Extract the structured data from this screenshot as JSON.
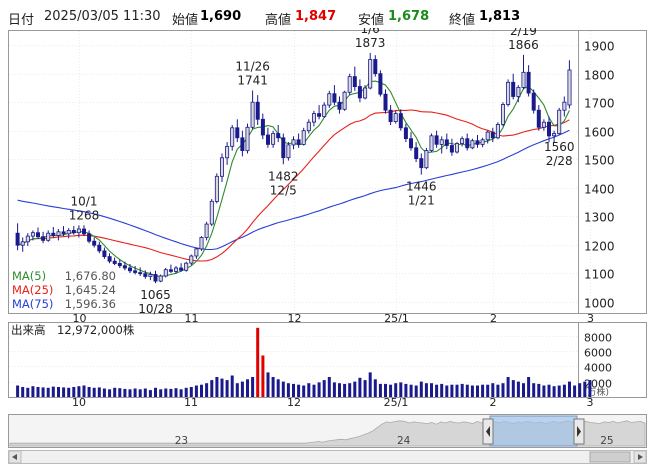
{
  "header": {
    "date_label": "日付",
    "datetime": "2025/03/05 11:30",
    "open_label": "始値",
    "open": "1,690",
    "high_label": "高値",
    "high": "1,847",
    "low_label": "安値",
    "low": "1,678",
    "close_label": "終値",
    "close": "1,813"
  },
  "colors": {
    "up": "#d9d9d9",
    "up_border": "#1a1a8c",
    "down": "#1a1a8c",
    "ma5": "#2e8b2e",
    "ma25": "#e8211a",
    "ma75": "#2a3fd6",
    "high": "#e00000",
    "low": "#1a8c1a",
    "volume": "#1a1a8c",
    "volume_spike": "#e00000"
  },
  "chart_data": {
    "type": "candlestick",
    "yticks": [
      1000,
      1100,
      1200,
      1300,
      1400,
      1500,
      1600,
      1700,
      1800,
      1900
    ],
    "ylim": [
      960,
      1950
    ],
    "x_month_labels": [
      {
        "label": "10",
        "index": 12
      },
      {
        "label": "11",
        "index": 34
      },
      {
        "label": "12",
        "index": 54
      },
      {
        "label": "25/1",
        "index": 74
      },
      {
        "label": "2",
        "index": 93
      },
      {
        "label": "3",
        "index": 112
      }
    ],
    "candles": [
      [
        1240,
        1275,
        1180,
        1198
      ],
      [
        1198,
        1225,
        1175,
        1210
      ],
      [
        1210,
        1240,
        1195,
        1230
      ],
      [
        1230,
        1250,
        1215,
        1242
      ],
      [
        1242,
        1260,
        1220,
        1228
      ],
      [
        1228,
        1245,
        1205,
        1215
      ],
      [
        1215,
        1250,
        1210,
        1240
      ],
      [
        1240,
        1262,
        1225,
        1232
      ],
      [
        1232,
        1255,
        1215,
        1245
      ],
      [
        1245,
        1265,
        1230,
        1238
      ],
      [
        1238,
        1258,
        1222,
        1250
      ],
      [
        1250,
        1265,
        1235,
        1242
      ],
      [
        1242,
        1268,
        1225,
        1255
      ],
      [
        1255,
        1268,
        1230,
        1238
      ],
      [
        1238,
        1250,
        1205,
        1212
      ],
      [
        1212,
        1225,
        1190,
        1198
      ],
      [
        1198,
        1210,
        1170,
        1178
      ],
      [
        1178,
        1190,
        1150,
        1158
      ],
      [
        1158,
        1170,
        1135,
        1142
      ],
      [
        1142,
        1155,
        1125,
        1134
      ],
      [
        1134,
        1148,
        1118,
        1126
      ],
      [
        1126,
        1140,
        1110,
        1118
      ],
      [
        1118,
        1132,
        1100,
        1108
      ],
      [
        1108,
        1125,
        1095,
        1102
      ],
      [
        1102,
        1120,
        1090,
        1098
      ],
      [
        1098,
        1110,
        1080,
        1088
      ],
      [
        1088,
        1105,
        1075,
        1095
      ],
      [
        1095,
        1108,
        1065,
        1072
      ],
      [
        1072,
        1095,
        1068,
        1090
      ],
      [
        1090,
        1118,
        1085,
        1112
      ],
      [
        1112,
        1130,
        1100,
        1106
      ],
      [
        1106,
        1125,
        1098,
        1118
      ],
      [
        1118,
        1135,
        1105,
        1110
      ],
      [
        1110,
        1140,
        1105,
        1135
      ],
      [
        1135,
        1165,
        1128,
        1160
      ],
      [
        1160,
        1190,
        1150,
        1185
      ],
      [
        1185,
        1230,
        1178,
        1225
      ],
      [
        1225,
        1280,
        1215,
        1272
      ],
      [
        1272,
        1360,
        1265,
        1352
      ],
      [
        1352,
        1450,
        1345,
        1440
      ],
      [
        1440,
        1520,
        1420,
        1505
      ],
      [
        1505,
        1560,
        1480,
        1545
      ],
      [
        1545,
        1620,
        1530,
        1610
      ],
      [
        1610,
        1640,
        1560,
        1575
      ],
      [
        1575,
        1600,
        1510,
        1530
      ],
      [
        1530,
        1625,
        1520,
        1612
      ],
      [
        1612,
        1741,
        1605,
        1700
      ],
      [
        1700,
        1725,
        1620,
        1640
      ],
      [
        1640,
        1660,
        1570,
        1585
      ],
      [
        1585,
        1610,
        1540,
        1552
      ],
      [
        1552,
        1600,
        1540,
        1590
      ],
      [
        1590,
        1620,
        1560,
        1575
      ],
      [
        1575,
        1590,
        1482,
        1505
      ],
      [
        1505,
        1560,
        1495,
        1550
      ],
      [
        1550,
        1580,
        1535,
        1568
      ],
      [
        1568,
        1590,
        1540,
        1552
      ],
      [
        1552,
        1610,
        1548,
        1600
      ],
      [
        1600,
        1640,
        1590,
        1630
      ],
      [
        1630,
        1670,
        1615,
        1660
      ],
      [
        1660,
        1690,
        1640,
        1650
      ],
      [
        1650,
        1700,
        1645,
        1690
      ],
      [
        1690,
        1740,
        1680,
        1730
      ],
      [
        1730,
        1760,
        1690,
        1700
      ],
      [
        1700,
        1720,
        1660,
        1675
      ],
      [
        1675,
        1740,
        1670,
        1735
      ],
      [
        1735,
        1800,
        1725,
        1790
      ],
      [
        1790,
        1825,
        1740,
        1755
      ],
      [
        1755,
        1780,
        1700,
        1715
      ],
      [
        1715,
        1760,
        1710,
        1750
      ],
      [
        1750,
        1873,
        1745,
        1850
      ],
      [
        1850,
        1865,
        1790,
        1800
      ],
      [
        1800,
        1812,
        1720,
        1728
      ],
      [
        1728,
        1745,
        1660,
        1672
      ],
      [
        1672,
        1690,
        1620,
        1632
      ],
      [
        1632,
        1670,
        1625,
        1660
      ],
      [
        1660,
        1675,
        1600,
        1610
      ],
      [
        1610,
        1625,
        1560,
        1572
      ],
      [
        1572,
        1595,
        1530,
        1540
      ],
      [
        1540,
        1560,
        1490,
        1502
      ],
      [
        1502,
        1520,
        1446,
        1470
      ],
      [
        1470,
        1540,
        1465,
        1530
      ],
      [
        1530,
        1590,
        1525,
        1582
      ],
      [
        1582,
        1600,
        1540,
        1552
      ],
      [
        1552,
        1580,
        1520,
        1568
      ],
      [
        1568,
        1590,
        1535,
        1548
      ],
      [
        1548,
        1572,
        1512,
        1525
      ],
      [
        1525,
        1560,
        1520,
        1555
      ],
      [
        1555,
        1580,
        1545,
        1572
      ],
      [
        1572,
        1590,
        1530,
        1540
      ],
      [
        1540,
        1572,
        1535,
        1565
      ],
      [
        1565,
        1585,
        1540,
        1552
      ],
      [
        1552,
        1575,
        1542,
        1568
      ],
      [
        1568,
        1600,
        1555,
        1595
      ],
      [
        1595,
        1610,
        1560,
        1575
      ],
      [
        1575,
        1630,
        1570,
        1622
      ],
      [
        1622,
        1700,
        1615,
        1692
      ],
      [
        1692,
        1780,
        1685,
        1770
      ],
      [
        1770,
        1800,
        1710,
        1720
      ],
      [
        1720,
        1760,
        1700,
        1752
      ],
      [
        1752,
        1866,
        1745,
        1805
      ],
      [
        1805,
        1830,
        1720,
        1732
      ],
      [
        1732,
        1745,
        1660,
        1672
      ],
      [
        1672,
        1690,
        1600,
        1612
      ],
      [
        1612,
        1640,
        1600,
        1630
      ],
      [
        1630,
        1650,
        1560,
        1582
      ],
      [
        1582,
        1600,
        1560,
        1590
      ],
      [
        1590,
        1680,
        1585,
        1672
      ],
      [
        1672,
        1720,
        1650,
        1700
      ],
      [
        1690,
        1847,
        1678,
        1813
      ]
    ],
    "ma5_last": "1,676.80",
    "ma25_last": "1,645.24",
    "ma75_last": "1,596.36",
    "annotations": [
      {
        "index": 13,
        "date": "10/1",
        "price": "1268",
        "pos": "above"
      },
      {
        "index": 27,
        "date": "10/28",
        "price": "1065",
        "pos": "below"
      },
      {
        "index": 46,
        "date": "11/26",
        "price": "1741",
        "pos": "above"
      },
      {
        "index": 52,
        "date": "12/5",
        "price": "1482",
        "pos": "below"
      },
      {
        "index": 69,
        "date": "1/6",
        "price": "1873",
        "pos": "above"
      },
      {
        "index": 79,
        "date": "1/21",
        "price": "1446",
        "pos": "below"
      },
      {
        "index": 99,
        "date": "2/19",
        "price": "1866",
        "pos": "above"
      },
      {
        "index": 106,
        "date": "2/28",
        "price": "1560",
        "pos": "below"
      }
    ],
    "ma_legend": [
      {
        "label": "MA(5)",
        "value": "1,676.80"
      },
      {
        "label": "MA(25)",
        "value": "1,645.24"
      },
      {
        "label": "MA(75)",
        "value": "1,596.36"
      }
    ],
    "volume": {
      "label": "出来高",
      "value": "12,972,000株",
      "unit": "(万株)",
      "yticks": [
        2000,
        4000,
        6000,
        8000
      ],
      "ylim": [
        0,
        9500
      ],
      "values": [
        1500,
        1300,
        1200,
        1400,
        1300,
        1250,
        1200,
        1350,
        1300,
        1250,
        1200,
        1300,
        1400,
        1500,
        1300,
        1200,
        1250,
        1100,
        1000,
        1200,
        1150,
        1050,
        1000,
        1100,
        1000,
        1100,
        900,
        1200,
        1000,
        1100,
        1050,
        1150,
        1000,
        1200,
        1300,
        1500,
        1600,
        1800,
        2200,
        2600,
        2400,
        2200,
        2800,
        1800,
        2000,
        2300,
        2600,
        9000,
        5400,
        3200,
        2600,
        2300,
        2000,
        1800,
        1700,
        1600,
        1500,
        1800,
        1600,
        1900,
        2200,
        2600,
        1900,
        1800,
        1700,
        1800,
        2000,
        2500,
        2200,
        3200,
        2300,
        1700,
        1700,
        1600,
        1800,
        1900,
        1700,
        1600,
        1500,
        2000,
        1800,
        1800,
        1600,
        1700,
        1500,
        1600,
        1600,
        1700,
        1600,
        1500,
        1500,
        1600,
        1600,
        1800,
        1600,
        1800,
        2600,
        2200,
        2000,
        1800,
        2600,
        1800,
        1700,
        1500,
        1600,
        1400,
        1500,
        1600,
        2000,
        1500,
        1800,
        2000,
        2200
      ]
    },
    "overview": {
      "labels": [
        {
          "label": "23",
          "pos": 0.27
        },
        {
          "label": "24",
          "pos": 0.62
        },
        {
          "label": "25",
          "pos": 0.94
        }
      ],
      "series": [
        60,
        60,
        60,
        60,
        60,
        60,
        60,
        60,
        60,
        60,
        60,
        60,
        60,
        60,
        60,
        60,
        60,
        60,
        60,
        60,
        60,
        60,
        60,
        60,
        60,
        60,
        60,
        60,
        60,
        60,
        60,
        60,
        60,
        60,
        60,
        60,
        60,
        60,
        60,
        60,
        60,
        60,
        60,
        60,
        60,
        60,
        60,
        60,
        60,
        60,
        60,
        60,
        60,
        60,
        60,
        60,
        60,
        60,
        60,
        60,
        60,
        60,
        60,
        60,
        60,
        60,
        61,
        62,
        63,
        62,
        64,
        65,
        66,
        67,
        66,
        68,
        70,
        72,
        75,
        78,
        82,
        88,
        94,
        98,
        97,
        99,
        100,
        99,
        96,
        98,
        97,
        96,
        95,
        97,
        94,
        98,
        96,
        99,
        97,
        96,
        98,
        97,
        95,
        99,
        96,
        100,
        97,
        98,
        96,
        99,
        97,
        95,
        98,
        96,
        99,
        97,
        96,
        98,
        95,
        97,
        99,
        96,
        98,
        100,
        97,
        96,
        98,
        99,
        97,
        96,
        95,
        98,
        97,
        99,
        96,
        98,
        100,
        97,
        98,
        99,
        96
      ]
    }
  }
}
